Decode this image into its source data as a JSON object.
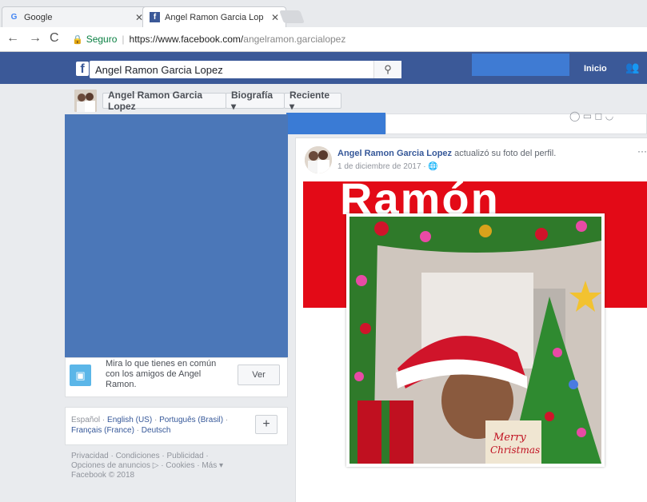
{
  "browser": {
    "tabs": [
      {
        "label": "Google",
        "icon": "google-icon"
      },
      {
        "label": "Angel Ramon Garcia Lop",
        "icon": "facebook-icon"
      }
    ],
    "secure_label": "Seguro",
    "url_host": "https://www.facebook.com/",
    "url_path": "angelramon.garcialopez"
  },
  "fb": {
    "logo": "f",
    "search_value": "Angel Ramon Garcia Lopez",
    "inicio": "Inicio"
  },
  "subnav": {
    "name": "Angel Ramon Garcia Lopez",
    "biografia": "Biografía ▾",
    "reciente": "Reciente ▾"
  },
  "common": {
    "text": "Mira lo que tienes en común con los amigos de Angel Ramon.",
    "button": "Ver"
  },
  "languages": {
    "current": "Español",
    "links": [
      "English (US)",
      "Português (Brasil)",
      "Français (France)",
      "Deutsch"
    ],
    "plus": "+"
  },
  "footer": {
    "line1": "Privacidad · Condiciones · Publicidad ·",
    "line2": "Opciones de anuncios ▷ · Cookies · Más ▾",
    "line3": "Facebook © 2018"
  },
  "post": {
    "author": "Angel Ramon Garcia Lopez",
    "action": " actualizó su foto del perfil.",
    "date": "1 de diciembre de 2017 · ",
    "privacy_icon": "globe-icon",
    "menu": "···",
    "banner_text": "Ramón",
    "merry": "Merry",
    "christmas": "Christmas"
  },
  "colors": {
    "fb_blue": "#3b5998",
    "redaction": "#4b77b8",
    "banner_red": "#e30a17"
  }
}
